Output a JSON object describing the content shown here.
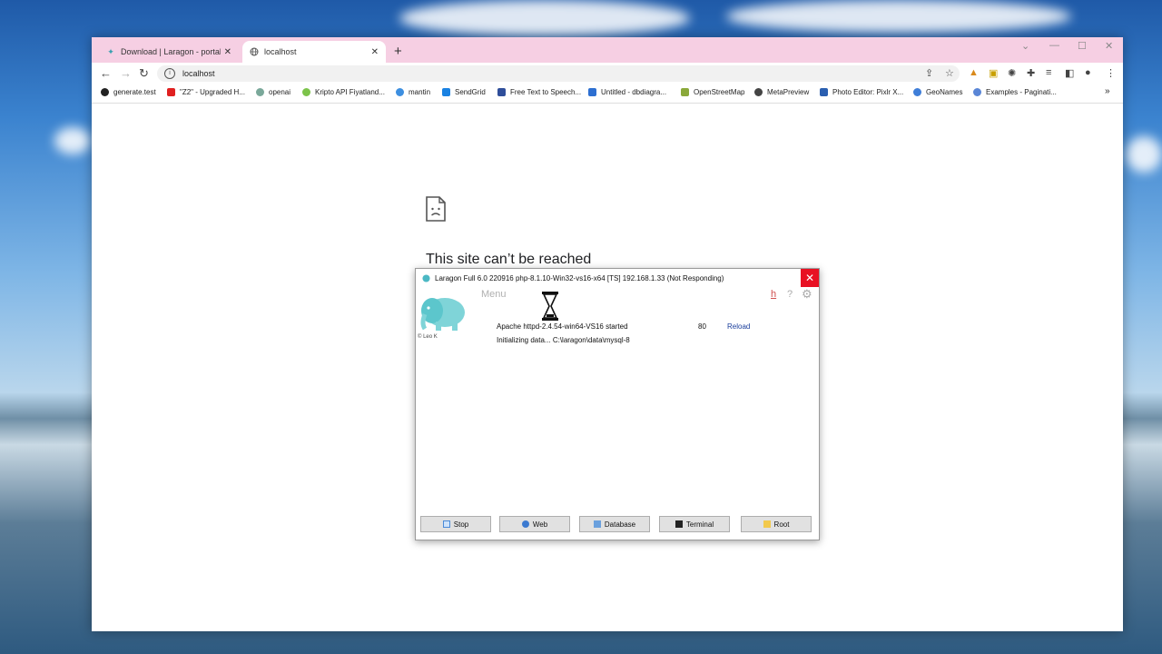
{
  "browser": {
    "tabs": [
      {
        "label": "Download | Laragon - portable, i",
        "active": false
      },
      {
        "label": "localhost",
        "active": true
      }
    ],
    "new_tab": "+",
    "window_controls": {
      "minimize": "—",
      "maximize": "☐",
      "close": "✕",
      "chevron": "⌄"
    },
    "address": "localhost",
    "bookmarks": [
      {
        "label": "generate.test",
        "color": "#222222"
      },
      {
        "label": "\"Z2\" - Upgraded H...",
        "color": "#e02020"
      },
      {
        "label": "openai",
        "color": "#7aa89a"
      },
      {
        "label": "Kripto API Fiyatland...",
        "color": "#7cc34a"
      },
      {
        "label": "mantin",
        "color": "#3d8fe0"
      },
      {
        "label": "SendGrid",
        "color": "#1a82e2"
      },
      {
        "label": "Free Text to Speech...",
        "color": "#2f4e9a"
      },
      {
        "label": "Untitled - dbdiagra...",
        "color": "#2d6fd1"
      },
      {
        "label": "OpenStreetMap",
        "color": "#8aa83a"
      },
      {
        "label": "MetaPreview",
        "color": "#444444"
      },
      {
        "label": "Photo Editor: Pixlr X...",
        "color": "#2a5fb0"
      },
      {
        "label": "GeoNames",
        "color": "#3f7ed8"
      },
      {
        "label": "Examples - Paginati...",
        "color": "#5a86d6"
      }
    ],
    "more_bookmarks": "»"
  },
  "page": {
    "error_title": "This site can’t be reached"
  },
  "laragon": {
    "title": "Laragon Full 6.0 220916 php-8.1.10-Win32-vs16-x64 [TS]  192.168.1.33 (Not Responding)",
    "close": "✕",
    "menu": "Menu",
    "credit": "© Leo K",
    "icons": {
      "h": "h",
      "help": "?",
      "settings": "⚙"
    },
    "status_line1": "Apache httpd-2.4.54-win64-VS16 started",
    "port": "80",
    "reload": "Reload",
    "status_line2": "Initializing data... C:\\laragon\\data\\mysql-8",
    "buttons": {
      "stop": "Stop",
      "web": "Web",
      "database": "Database",
      "terminal": "Terminal",
      "root": "Root"
    }
  }
}
